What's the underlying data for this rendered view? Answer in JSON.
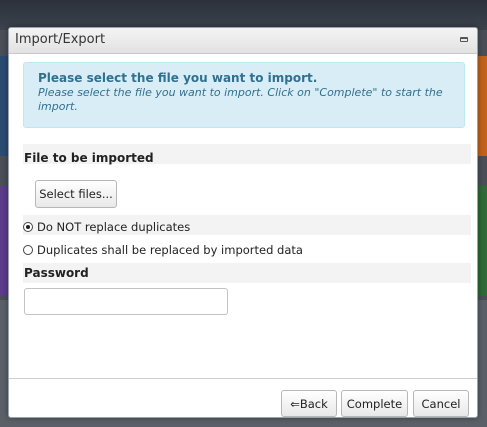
{
  "dialog": {
    "title": "Import/Export",
    "minimize_icon": "minimize-icon"
  },
  "info": {
    "heading": "Please select the file you want to import.",
    "description": "Please select the file you want to import. Click on \"Complete\" to start the import."
  },
  "file_section": {
    "label": "File to be imported",
    "select_button": "Select files..."
  },
  "duplicates": {
    "options": [
      {
        "label": "Do NOT replace duplicates",
        "checked": true
      },
      {
        "label": "Duplicates shall be replaced by imported data",
        "checked": false
      }
    ]
  },
  "password": {
    "label": "Password",
    "value": "",
    "placeholder": ""
  },
  "footer": {
    "back_label": "⇐Back",
    "complete_label": "Complete",
    "cancel_label": "Cancel"
  }
}
